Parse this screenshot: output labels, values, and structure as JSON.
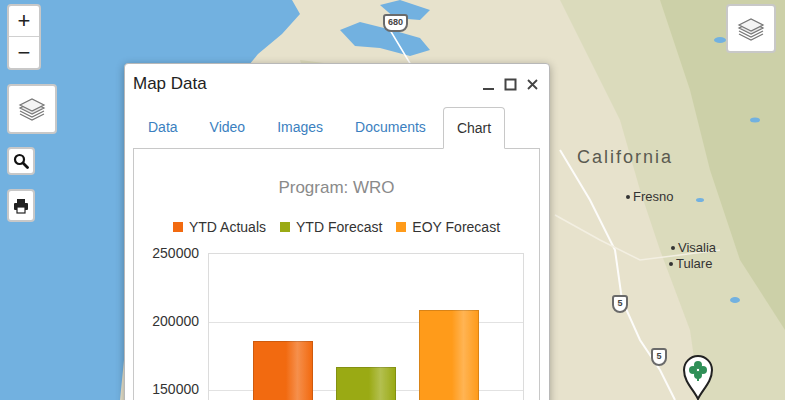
{
  "map": {
    "region_label": "California",
    "places": [
      {
        "name": "Fresno"
      },
      {
        "name": "Visalia"
      },
      {
        "name": "Tulare"
      }
    ],
    "shields": [
      "680",
      "5",
      "5"
    ]
  },
  "controls": {
    "zoom_in": "+",
    "zoom_out": "−"
  },
  "window": {
    "title": "Map Data"
  },
  "tabs": [
    {
      "label": "Data",
      "selected": false
    },
    {
      "label": "Video",
      "selected": false
    },
    {
      "label": "Images",
      "selected": false
    },
    {
      "label": "Documents",
      "selected": false
    },
    {
      "label": "Chart",
      "selected": true
    }
  ],
  "chart": {
    "title": "Program: WRO",
    "y_ticks": [
      "250000",
      "200000",
      "150000"
    ],
    "series": [
      {
        "name": "YTD Actuals",
        "color": "#f26a10",
        "values": [
          185000
        ]
      },
      {
        "name": "YTD Forecast",
        "color": "#9aaa14",
        "values": [
          166000
        ]
      },
      {
        "name": "EOY Forecast",
        "color": "#ff9b1a",
        "values": [
          208000
        ]
      }
    ]
  }
}
